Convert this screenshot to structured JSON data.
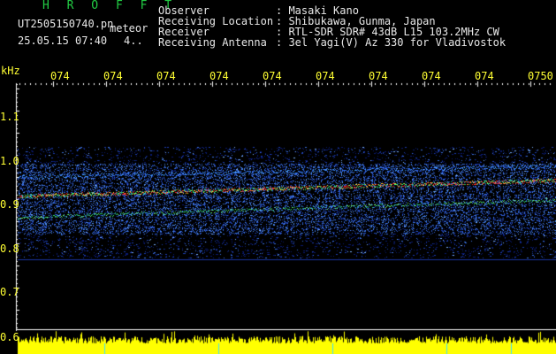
{
  "header": {
    "app_title": "H R O F F T",
    "file_name": "UT2505150740.pn",
    "mode_label": "meteor",
    "datetime": "25.05.15 07:40",
    "frame_no": "4..",
    "info": [
      {
        "label": "Observer",
        "value": ": Masaki Kano"
      },
      {
        "label": "Receiving Location",
        "value": ": Shibukawa, Gunma, Japan"
      },
      {
        "label": "Receiver",
        "value": ": RTL-SDR SDR# 43dB L15 103.2MHz CW"
      },
      {
        "label": "Receiving Antenna",
        "value": ": 3el Yagi(V) Az 330 for Vladivostok"
      }
    ]
  },
  "axes": {
    "y_unit": "kHz",
    "y_ticks": [
      "1.1",
      "1.0",
      "0.9",
      "0.8",
      "0.7",
      "0.6"
    ],
    "x_ticks": [
      "074",
      "074",
      "074",
      "074",
      "074",
      "074",
      "074",
      "074",
      "074",
      "0750"
    ]
  },
  "colors": {
    "title": "#22cc44",
    "labels": "#ffff33",
    "info_text": "#e8e8e8",
    "noise_band": "#2040c0",
    "echo_line": "#ff3030",
    "level_bar": "#ffff00"
  }
}
